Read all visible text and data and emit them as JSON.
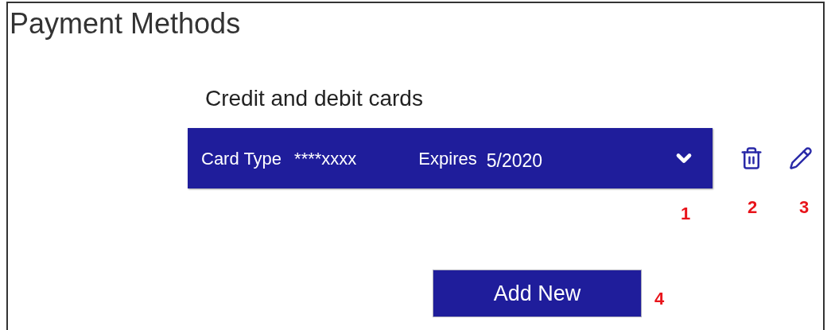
{
  "title": "Payment Methods",
  "section_title": "Credit and debit cards",
  "cards": [
    {
      "type_label": "Card Type",
      "number": "****xxxx",
      "expires_label": "Expires",
      "expires": "5/2020",
      "expanded": false
    }
  ],
  "add_button": "Add New",
  "callouts": [
    "1",
    "2",
    "3",
    "4"
  ]
}
